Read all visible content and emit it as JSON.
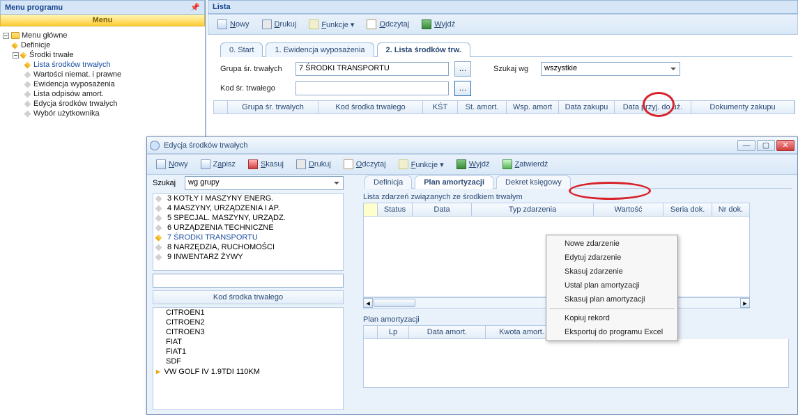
{
  "left": {
    "title": "Menu programu",
    "menu_label": "Menu",
    "root": "Menu główne",
    "definicje": "Definicje",
    "srodki": "Środki trwałe",
    "items": [
      "Lista środków trwałych",
      "Wartości niemat. i prawne",
      "Ewidencja wyposażenia",
      "Lista odpisów amort.",
      "Edycja środków trwałych",
      "Wybór użytkownika"
    ],
    "selected_index": 0
  },
  "right": {
    "title": "Lista",
    "toolbar": {
      "nowy": "Nowy",
      "drukuj": "Drukuj",
      "funkcje": "Funkcje",
      "odczytaj": "Odczytaj",
      "wyjdz": "Wyjdź"
    },
    "tabs": [
      "0. Start",
      "1. Ewidencja wyposażenia",
      "2. Lista środków trw."
    ],
    "active_tab": 2,
    "form": {
      "grupa_label": "Grupa śr. trwałych",
      "grupa_value": "7 ŚRODKI TRANSPORTU",
      "kod_label": "Kod śr. trwałego",
      "kod_value": "",
      "szukaj_label": "Szukaj wg",
      "szukaj_value": "wszystkie"
    },
    "grid_cols": [
      "Grupa śr. trwałych",
      "Kod środka trwałego",
      "KŚT",
      "St. amort.",
      "Wsp. amort",
      "Data zakupu",
      "Data przyj. do uż.",
      "Dokumenty zakupu"
    ]
  },
  "subwin": {
    "title": "Edycja środków trwałych",
    "toolbar": {
      "nowy": "Nowy",
      "zapisz": "Zapisz",
      "skasuj": "Skasuj",
      "drukuj": "Drukuj",
      "odczytaj": "Odczytaj",
      "funkcje": "Funkcje",
      "wyjdz": "Wyjdź",
      "zatwierdz": "Zatwierdź"
    },
    "szukaj_label": "Szukaj",
    "szukaj_value": "wg grupy",
    "groups": [
      "3 KOTŁY I MASZYNY ENERG.",
      "4 MASZYNY, URZĄDZENIA I AP.",
      "5 SPECJAL. MASZYNY, URZĄDZ.",
      "6 URZĄDZENIA TECHNICZNE",
      "7 ŚRODKI TRANSPORTU",
      "8 NARZĘDZIA, RUCHOMOŚCI",
      "9 INWENTARZ ŻYWY"
    ],
    "selected_group_index": 4,
    "kod_col": "Kod środka trwałego",
    "assets": [
      "CITROEN1",
      "CITROEN2",
      "CITROEN3",
      "FIAT",
      "FIAT1",
      "SDF",
      "VW GOLF IV 1.9TDI 110KM"
    ],
    "selected_asset_index": 6,
    "inner_tabs": [
      "Definicja",
      "Plan amortyzacji",
      "Dekret księgowy"
    ],
    "active_inner": 1,
    "list_label": "Lista zdarzeń związanych ze środkiem trwałym",
    "event_cols": [
      "",
      "Status",
      "Data",
      "Typ zdarzenia",
      "Wartość",
      "Seria dok.",
      "Nr dok."
    ],
    "plan_label": "Plan amortyzacji",
    "plan_cols": [
      "",
      "Lp",
      "Data amort.",
      "Kwota amort."
    ],
    "context": [
      "Nowe zdarzenie",
      "Edytuj zdarzenie",
      "Skasuj zdarzenie",
      "Ustal plan amortyzacji",
      "Skasuj plan amortyzacji",
      "Kopiuj rekord",
      "Eksportuj do programu Excel"
    ]
  }
}
